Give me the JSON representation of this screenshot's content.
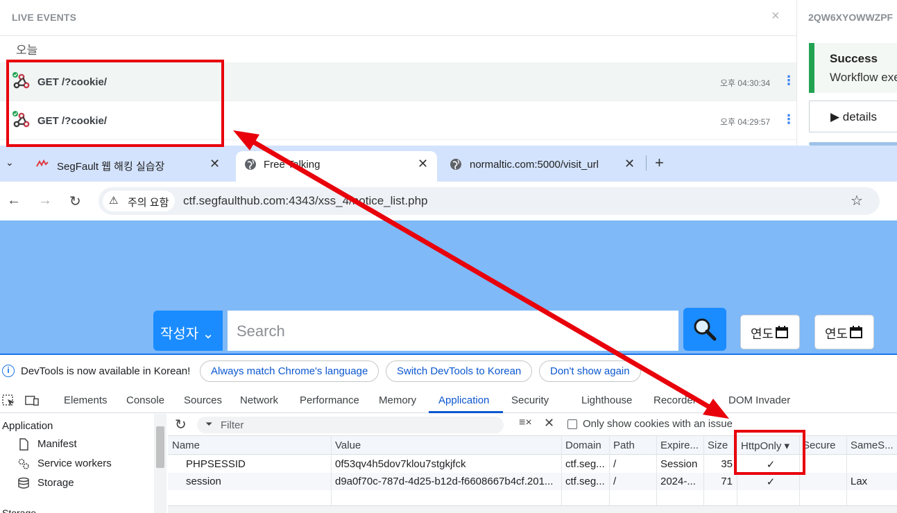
{
  "live_events": {
    "title": "LIVE EVENTS",
    "close": "×",
    "day_label": "오늘",
    "rows": [
      {
        "request": "GET /?cookie/",
        "time": "오후 04:30:34"
      },
      {
        "request": "GET /?cookie/",
        "time": "오후 04:29:57"
      }
    ],
    "kebab": "⋮"
  },
  "side_panel": {
    "id": "2QW6XYOWWZPF",
    "success_title": "Success",
    "success_text": "Workflow exe",
    "details_label": "▶ details"
  },
  "browser": {
    "tab_menu": "⌄",
    "tabs": [
      {
        "label": "SegFault 웹 해킹 실습장",
        "close": "✕"
      },
      {
        "label": "Free Talking",
        "close": "✕"
      },
      {
        "label": "normaltic.com:5000/visit_url",
        "close": "✕"
      }
    ],
    "new_tab": "+",
    "back": "←",
    "forward": "→",
    "reload": "↻",
    "warning_icon": "⚠",
    "warning_label": "주의 요함",
    "url": "ctf.segfaulthub.com:4343/xss_4/notice_list.php",
    "star": "☆"
  },
  "page": {
    "author_label": "작성자 ⌄",
    "search_placeholder": "Search",
    "date_placeholder": "연도"
  },
  "devtools": {
    "info_icon": "i",
    "info_text": "DevTools is now available in Korean!",
    "buttons": [
      "Always match Chrome's language",
      "Switch DevTools to Korean",
      "Don't show again"
    ],
    "tabs": [
      "Elements",
      "Console",
      "Sources",
      "Network",
      "Performance",
      "Memory",
      "Application",
      "Security",
      "Lighthouse",
      "Recorder",
      "DOM Invader"
    ],
    "active_tab": "Application",
    "sidebar": {
      "heading": "Application",
      "items": [
        "Manifest",
        "Service workers",
        "Storage"
      ],
      "bottom_label": "Storage"
    },
    "cookies": {
      "filter_icon": "⏷",
      "filter_placeholder": "Filter",
      "clear_icon": "≡×",
      "close_icon": "✕",
      "only_issue_label": "Only show cookies with an issue",
      "columns": [
        "Name",
        "Value",
        "Domain",
        "Path",
        "Expire...",
        "Size",
        "HttpOnly ▾",
        "Secure",
        "SameS..."
      ],
      "rows": [
        [
          "PHPSESSID",
          "0f53qv4h5dov7klou7stgkjfck",
          "ctf.seg...",
          "/",
          "Session",
          "35",
          "✓",
          "",
          ""
        ],
        [
          "session",
          "d9a0f70c-787d-4d25-b12d-f6608667b4cf.201...",
          "ctf.seg...",
          "/",
          "2024-...",
          "71",
          "✓",
          "",
          "Lax"
        ]
      ]
    }
  },
  "colors": {
    "accent_red": "#e8000b",
    "devtools_blue": "#0b57d0",
    "page_bg": "#7fb9f8",
    "button_blue": "#1a8cff",
    "success_green": "#22a352"
  }
}
